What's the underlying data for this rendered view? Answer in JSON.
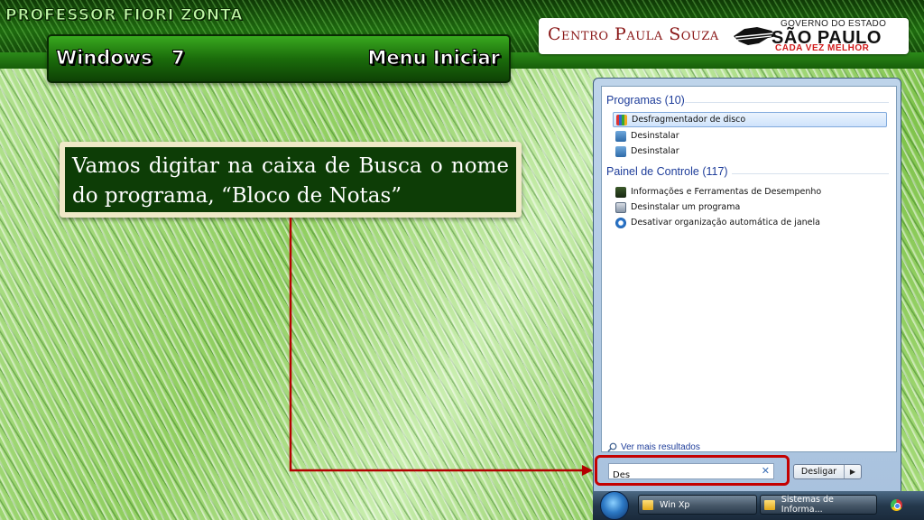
{
  "header": {
    "professor": "PROFESSOR FIORI ZONTA",
    "left_title": "Windows 7",
    "right_title": "Menu Iniciar"
  },
  "logos": {
    "centro": "Centro Paula Souza",
    "gov_small": "GOVERNO DO ESTADO",
    "gov_big": "SÃO PAULO",
    "gov_tag": "CADA VEZ MELHOR"
  },
  "callout": {
    "text": "Vamos digitar na caixa de Busca o nome do programa, “Bloco de Notas”"
  },
  "start_menu": {
    "programs_header": "Programas (10)",
    "programs": [
      {
        "label": "Desfragmentador de disco",
        "icon": "defrag-icon",
        "selected": true
      },
      {
        "label": "Desinstalar",
        "icon": "uninstall-icon",
        "selected": false
      },
      {
        "label": "Desinstalar",
        "icon": "uninstall-icon",
        "selected": false
      }
    ],
    "control_header": "Painel de Controle (117)",
    "control_items": [
      {
        "label": "Informações e Ferramentas de Desempenho",
        "icon": "performance-icon"
      },
      {
        "label": "Desinstalar um programa",
        "icon": "programs-icon"
      },
      {
        "label": "Desativar organização automática de janela",
        "icon": "ease-of-access-icon"
      }
    ],
    "see_more": "Ver mais resultados",
    "search_value": "Des",
    "shutdown_label": "Desligar"
  },
  "taskbar": {
    "items": [
      {
        "label": "Win Xp"
      },
      {
        "label": "Sistemas de Informa..."
      }
    ]
  },
  "colors": {
    "accent_green": "#1b6c0b",
    "highlight_red": "#c40000",
    "link_blue": "#1e3d9a"
  }
}
